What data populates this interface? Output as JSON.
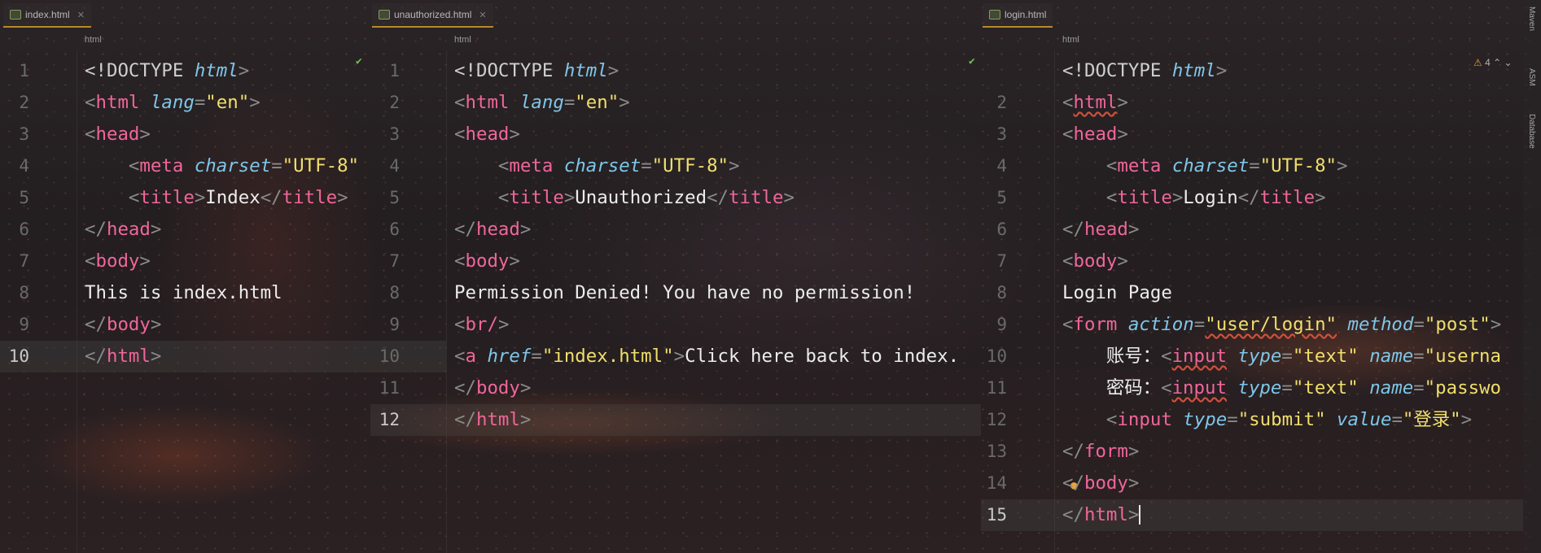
{
  "tabs": [
    {
      "label": "index.html"
    },
    {
      "label": "unauthorized.html"
    },
    {
      "label": "login.html"
    }
  ],
  "breadcrumbs": [
    "html",
    "html",
    "html"
  ],
  "sidebar": {
    "items": [
      "Maven",
      "ASM",
      "Database"
    ]
  },
  "warnings": {
    "count": "4"
  },
  "editor1": {
    "lines": [
      "1",
      "2",
      "3",
      "4",
      "5",
      "6",
      "7",
      "8",
      "9",
      "10"
    ],
    "doctype": "<!DOCTYPE",
    "doctype_val": "html",
    "html_open": "html",
    "lang_attr": "lang",
    "lang_val": "\"en\"",
    "head": "head",
    "meta": "meta",
    "charset_attr": "charset",
    "charset_val": "\"UTF-8\"",
    "title_tag": "title",
    "title_text": "Index",
    "body": "body",
    "body_text": "This is index.html"
  },
  "editor2": {
    "lines": [
      "1",
      "2",
      "3",
      "4",
      "5",
      "6",
      "7",
      "8",
      "9",
      "10",
      "11",
      "12"
    ],
    "title_text": "Unauthorized",
    "body_text": "Permission Denied! You have no permission!",
    "br": "br/",
    "a": "a",
    "href_attr": "href",
    "href_val": "\"index.html\"",
    "link_text": "Click here back to index."
  },
  "editor3": {
    "lines": [
      "2",
      "3",
      "4",
      "5",
      "6",
      "7",
      "8",
      "9",
      "10",
      "11",
      "12",
      "13",
      "14",
      "15"
    ],
    "title_text": "Login",
    "body_text": "Login Page",
    "form": "form",
    "action_attr": "action",
    "action_val": "\"user/login\"",
    "method_attr": "method",
    "method_val": "\"post\"",
    "account_label": "账号：",
    "password_label": "密码：",
    "input": "input",
    "type_attr": "type",
    "type_text": "\"text\"",
    "name_attr": "name",
    "name_user": "\"userna",
    "name_pass": "\"passwo",
    "type_submit": "\"submit\"",
    "value_attr": "value",
    "value_val": "\"登录\""
  }
}
